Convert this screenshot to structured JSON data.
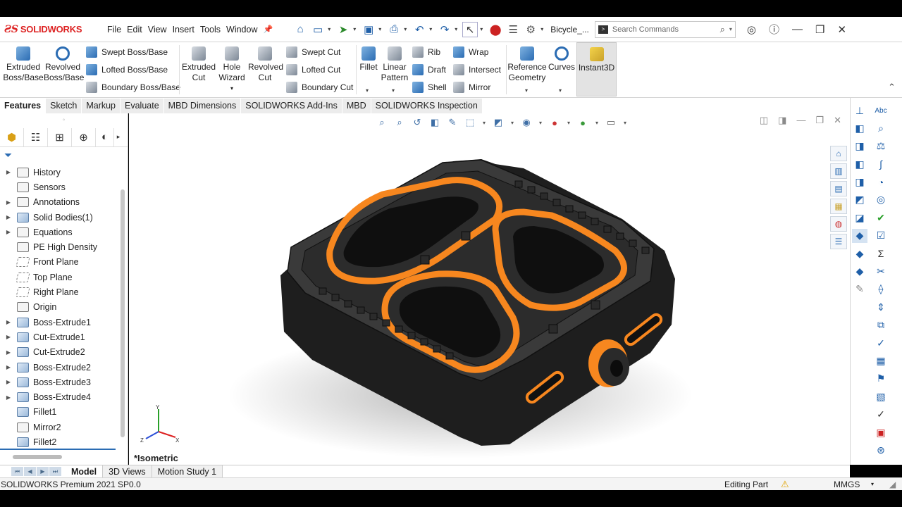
{
  "app": {
    "brand": "SOLIDWORKS",
    "document_title": "Bicycle_...",
    "menu": [
      "File",
      "Edit",
      "View",
      "Insert",
      "Tools",
      "Window"
    ]
  },
  "search": {
    "placeholder": "Search Commands"
  },
  "ribbon": {
    "extruded_boss": "Extruded Boss/Base",
    "revolved_boss": "Revolved Boss/Base",
    "swept_boss": "Swept Boss/Base",
    "lofted_boss": "Lofted Boss/Base",
    "boundary_boss": "Boundary Boss/Base",
    "extruded_cut": "Extruded Cut",
    "hole_wizard": "Hole Wizard",
    "revolved_cut": "Revolved Cut",
    "swept_cut": "Swept Cut",
    "lofted_cut": "Lofted Cut",
    "boundary_cut": "Boundary Cut",
    "fillet": "Fillet",
    "linear_pattern": "Linear Pattern",
    "rib": "Rib",
    "draft": "Draft",
    "shell": "Shell",
    "wrap": "Wrap",
    "intersect": "Intersect",
    "mirror": "Mirror",
    "reference_geometry": "Reference Geometry",
    "curves": "Curves",
    "instant3d": "Instant3D"
  },
  "command_tabs": [
    "Features",
    "Sketch",
    "Markup",
    "Evaluate",
    "MBD Dimensions",
    "SOLIDWORKS Add-Ins",
    "MBD",
    "SOLIDWORKS Inspection"
  ],
  "feature_tree": [
    {
      "label": "History",
      "expand": true,
      "icon": "history-icon"
    },
    {
      "label": "Sensors",
      "expand": false,
      "icon": "sensors-icon"
    },
    {
      "label": "Annotations",
      "expand": true,
      "icon": "annotations-icon"
    },
    {
      "label": "Solid Bodies(1)",
      "expand": true,
      "icon": "solid-bodies-icon"
    },
    {
      "label": "Equations",
      "expand": true,
      "icon": "equations-icon"
    },
    {
      "label": "PE High Density",
      "expand": false,
      "icon": "material-icon"
    },
    {
      "label": "Front Plane",
      "expand": false,
      "icon": "plane-icon"
    },
    {
      "label": "Top Plane",
      "expand": false,
      "icon": "plane-icon"
    },
    {
      "label": "Right Plane",
      "expand": false,
      "icon": "plane-icon"
    },
    {
      "label": "Origin",
      "expand": false,
      "icon": "origin-icon"
    },
    {
      "label": "Boss-Extrude1",
      "expand": true,
      "icon": "extrude-icon"
    },
    {
      "label": "Cut-Extrude1",
      "expand": true,
      "icon": "cut-icon"
    },
    {
      "label": "Cut-Extrude2",
      "expand": true,
      "icon": "cut-icon"
    },
    {
      "label": "Boss-Extrude2",
      "expand": true,
      "icon": "extrude-icon"
    },
    {
      "label": "Boss-Extrude3",
      "expand": true,
      "icon": "extrude-icon"
    },
    {
      "label": "Boss-Extrude4",
      "expand": true,
      "icon": "extrude-icon"
    },
    {
      "label": "Fillet1",
      "expand": false,
      "icon": "fillet-icon"
    },
    {
      "label": "Mirror2",
      "expand": false,
      "icon": "mirror-icon"
    },
    {
      "label": "Fillet2",
      "expand": false,
      "icon": "fillet-icon"
    }
  ],
  "viewport": {
    "view_label": "*Isometric",
    "triad": {
      "x": "X",
      "y": "Y",
      "z": "Z"
    }
  },
  "bottom_tabs": [
    "Model",
    "3D Views",
    "Motion Study 1"
  ],
  "status": {
    "app_version": "SOLIDWORKS Premium 2021 SP0.0",
    "mode": "Editing Part",
    "units": "MMGS"
  },
  "colors": {
    "accent_orange": "#f7871f",
    "part_dark": "#2a2a2a",
    "brand_red": "#d22222"
  }
}
